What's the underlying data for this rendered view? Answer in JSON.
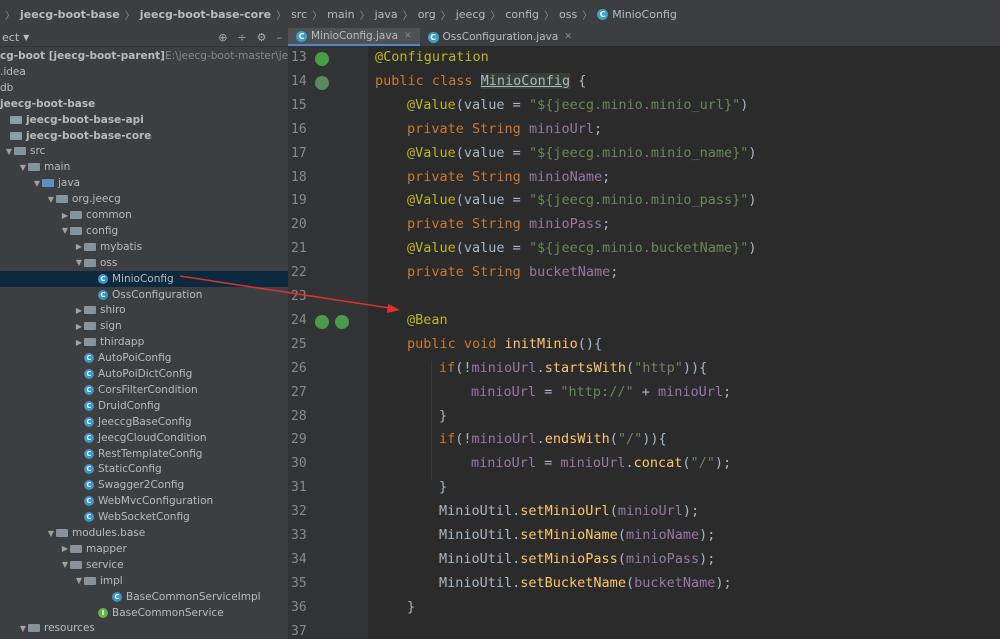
{
  "breadcrumb": [
    {
      "label": "jeecg-boot-base",
      "bold": true
    },
    {
      "label": "jeecg-boot-base-core",
      "bold": true
    },
    {
      "label": "src",
      "bold": false
    },
    {
      "label": "main",
      "bold": false
    },
    {
      "label": "java",
      "bold": false
    },
    {
      "label": "org",
      "bold": false
    },
    {
      "label": "jeecg",
      "bold": false
    },
    {
      "label": "config",
      "bold": false
    },
    {
      "label": "oss",
      "bold": false
    },
    {
      "label": "MinioConfig",
      "bold": false
    }
  ],
  "project_panel": {
    "title": "ect",
    "tree": [
      {
        "label": "cg-boot [jeecg-boot-parent]",
        "suffix": " E:\\jeecg-boot-master\\jeecg-boot",
        "indent": 0,
        "arrow": "",
        "icon": "",
        "bold": true
      },
      {
        "label": ".idea",
        "indent": 0,
        "arrow": "",
        "icon": "",
        "bold": false
      },
      {
        "label": "db",
        "indent": 0,
        "arrow": "",
        "icon": "",
        "bold": false
      },
      {
        "label": "jeecg-boot-base",
        "indent": 0,
        "arrow": "",
        "icon": "",
        "bold": true
      },
      {
        "label": "jeecg-boot-base-api",
        "indent": 0,
        "arrow": "",
        "icon": "folder-mod",
        "bold": true
      },
      {
        "label": "jeecg-boot-base-core",
        "indent": 0,
        "arrow": "",
        "icon": "folder-mod",
        "bold": true
      },
      {
        "label": "src",
        "indent": 0,
        "arrow": "▼",
        "icon": "folder",
        "bold": false
      },
      {
        "label": "main",
        "indent": 1,
        "arrow": "▼",
        "icon": "folder",
        "bold": false
      },
      {
        "label": "java",
        "indent": 2,
        "arrow": "▼",
        "icon": "folder-blue",
        "bold": false
      },
      {
        "label": "org.jeecg",
        "indent": 3,
        "arrow": "▼",
        "icon": "folder",
        "bold": false
      },
      {
        "label": "common",
        "indent": 4,
        "arrow": "▶",
        "icon": "folder",
        "bold": false
      },
      {
        "label": "config",
        "indent": 4,
        "arrow": "▼",
        "icon": "folder",
        "bold": false
      },
      {
        "label": "mybatis",
        "indent": 5,
        "arrow": "▶",
        "icon": "folder",
        "bold": false
      },
      {
        "label": "oss",
        "indent": 5,
        "arrow": "▼",
        "icon": "folder",
        "bold": false
      },
      {
        "label": "MinioConfig",
        "indent": 6,
        "arrow": "",
        "icon": "class",
        "bold": false,
        "selected": true
      },
      {
        "label": "OssConfiguration",
        "indent": 6,
        "arrow": "",
        "icon": "class",
        "bold": false
      },
      {
        "label": "shiro",
        "indent": 5,
        "arrow": "▶",
        "icon": "folder",
        "bold": false
      },
      {
        "label": "sign",
        "indent": 5,
        "arrow": "▶",
        "icon": "folder",
        "bold": false
      },
      {
        "label": "thirdapp",
        "indent": 5,
        "arrow": "▶",
        "icon": "folder",
        "bold": false
      },
      {
        "label": "AutoPoiConfig",
        "indent": 5,
        "arrow": "",
        "icon": "class",
        "bold": false
      },
      {
        "label": "AutoPoiDictConfig",
        "indent": 5,
        "arrow": "",
        "icon": "class",
        "bold": false
      },
      {
        "label": "CorsFilterCondition",
        "indent": 5,
        "arrow": "",
        "icon": "class",
        "bold": false
      },
      {
        "label": "DruidConfig",
        "indent": 5,
        "arrow": "",
        "icon": "class",
        "bold": false
      },
      {
        "label": "JeeccgBaseConfig",
        "indent": 5,
        "arrow": "",
        "icon": "class",
        "bold": false
      },
      {
        "label": "JeecgCloudCondition",
        "indent": 5,
        "arrow": "",
        "icon": "class",
        "bold": false
      },
      {
        "label": "RestTemplateConfig",
        "indent": 5,
        "arrow": "",
        "icon": "class",
        "bold": false
      },
      {
        "label": "StaticConfig",
        "indent": 5,
        "arrow": "",
        "icon": "class",
        "bold": false
      },
      {
        "label": "Swagger2Config",
        "indent": 5,
        "arrow": "",
        "icon": "class",
        "bold": false
      },
      {
        "label": "WebMvcConfiguration",
        "indent": 5,
        "arrow": "",
        "icon": "class",
        "bold": false
      },
      {
        "label": "WebSocketConfig",
        "indent": 5,
        "arrow": "",
        "icon": "class",
        "bold": false
      },
      {
        "label": "modules.base",
        "indent": 3,
        "arrow": "▼",
        "icon": "folder",
        "bold": false
      },
      {
        "label": "mapper",
        "indent": 4,
        "arrow": "▶",
        "icon": "folder",
        "bold": false
      },
      {
        "label": "service",
        "indent": 4,
        "arrow": "▼",
        "icon": "folder",
        "bold": false
      },
      {
        "label": "impl",
        "indent": 5,
        "arrow": "▼",
        "icon": "folder",
        "bold": false
      },
      {
        "label": "BaseCommonServiceImpl",
        "indent": 7,
        "arrow": "",
        "icon": "class",
        "bold": false
      },
      {
        "label": "BaseCommonService",
        "indent": 6,
        "arrow": "",
        "icon": "interface",
        "bold": false
      },
      {
        "label": "resources",
        "indent": 1,
        "arrow": "▼",
        "icon": "folder",
        "bold": false
      }
    ]
  },
  "tabs": [
    {
      "label": "MinioConfig.java",
      "active": true
    },
    {
      "label": "OssConfiguration.java",
      "active": false
    }
  ],
  "editor": {
    "lines": [
      {
        "n": "13",
        "ind": 0,
        "tokens": [
          [
            "ann",
            "@Configuration"
          ]
        ]
      },
      {
        "n": "14",
        "ind": 0,
        "tokens": [
          [
            "kw",
            "public class "
          ],
          [
            "classname",
            "MinioConfig"
          ],
          [
            "cls2",
            " {"
          ]
        ]
      },
      {
        "n": "15",
        "ind": 1,
        "tokens": [
          [
            "ann",
            "@Value"
          ],
          [
            "cls2",
            "(value = "
          ],
          [
            "str",
            "\"${jeecg.minio.minio_url}\""
          ],
          [
            "cls2",
            ")"
          ]
        ]
      },
      {
        "n": "16",
        "ind": 1,
        "tokens": [
          [
            "kw",
            "private "
          ],
          [
            "kw",
            "String "
          ],
          [
            "fld",
            "minioUrl"
          ],
          [
            "cls2",
            ";"
          ]
        ]
      },
      {
        "n": "17",
        "ind": 1,
        "tokens": [
          [
            "ann",
            "@Value"
          ],
          [
            "cls2",
            "(value = "
          ],
          [
            "str",
            "\"${jeecg.minio.minio_name}\""
          ],
          [
            "cls2",
            ")"
          ]
        ]
      },
      {
        "n": "18",
        "ind": 1,
        "tokens": [
          [
            "kw",
            "private "
          ],
          [
            "kw",
            "String "
          ],
          [
            "fld",
            "minioName"
          ],
          [
            "cls2",
            ";"
          ]
        ]
      },
      {
        "n": "19",
        "ind": 1,
        "tokens": [
          [
            "ann",
            "@Value"
          ],
          [
            "cls2",
            "(value = "
          ],
          [
            "str",
            "\"${jeecg.minio.minio_pass}\""
          ],
          [
            "cls2",
            ")"
          ]
        ]
      },
      {
        "n": "20",
        "ind": 1,
        "tokens": [
          [
            "kw",
            "private "
          ],
          [
            "kw",
            "String "
          ],
          [
            "fld",
            "minioPass"
          ],
          [
            "cls2",
            ";"
          ]
        ]
      },
      {
        "n": "21",
        "ind": 1,
        "tokens": [
          [
            "ann",
            "@Value"
          ],
          [
            "cls2",
            "(value = "
          ],
          [
            "str",
            "\"${jeecg.minio.bucketName}\""
          ],
          [
            "cls2",
            ")"
          ]
        ]
      },
      {
        "n": "22",
        "ind": 1,
        "tokens": [
          [
            "kw",
            "private "
          ],
          [
            "kw",
            "String "
          ],
          [
            "fld",
            "bucketName"
          ],
          [
            "cls2",
            ";"
          ]
        ]
      },
      {
        "n": "23",
        "ind": 0,
        "tokens": []
      },
      {
        "n": "24",
        "ind": 1,
        "tokens": [
          [
            "ann",
            "@Bean"
          ]
        ]
      },
      {
        "n": "25",
        "ind": 1,
        "tokens": [
          [
            "kw",
            "public void "
          ],
          [
            "mth",
            "initMinio"
          ],
          [
            "cls2",
            "(){"
          ]
        ]
      },
      {
        "n": "26",
        "ind": 2,
        "tokens": [
          [
            "kw",
            "if"
          ],
          [
            "cls2",
            "(!"
          ],
          [
            "fld",
            "minioUrl"
          ],
          [
            "cls2",
            "."
          ],
          [
            "mth",
            "startsWith"
          ],
          [
            "cls2",
            "("
          ],
          [
            "str",
            "\"http\""
          ],
          [
            "cls2",
            ")){"
          ]
        ]
      },
      {
        "n": "27",
        "ind": 3,
        "tokens": [
          [
            "fld",
            "minioUrl"
          ],
          [
            "cls2",
            " = "
          ],
          [
            "str",
            "\"http://\""
          ],
          [
            "cls2",
            " + "
          ],
          [
            "fld",
            "minioUrl"
          ],
          [
            "cls2",
            ";"
          ]
        ]
      },
      {
        "n": "28",
        "ind": 2,
        "tokens": [
          [
            "cls2",
            "}"
          ]
        ]
      },
      {
        "n": "29",
        "ind": 2,
        "tokens": [
          [
            "kw",
            "if"
          ],
          [
            "cls2",
            "(!"
          ],
          [
            "fld",
            "minioUrl"
          ],
          [
            "cls2",
            "."
          ],
          [
            "mth",
            "endsWith"
          ],
          [
            "cls2",
            "("
          ],
          [
            "str",
            "\"/\""
          ],
          [
            "cls2",
            "))"
          ],
          [
            "cls2",
            "{"
          ]
        ]
      },
      {
        "n": "30",
        "ind": 3,
        "tokens": [
          [
            "fld",
            "minioUrl"
          ],
          [
            "cls2",
            " = "
          ],
          [
            "fld",
            "minioUrl"
          ],
          [
            "cls2",
            "."
          ],
          [
            "mth",
            "concat"
          ],
          [
            "cls2",
            "("
          ],
          [
            "str",
            "\"/\""
          ],
          [
            "cls2",
            ");"
          ]
        ]
      },
      {
        "n": "31",
        "ind": 2,
        "tokens": [
          [
            "cls2",
            "}"
          ]
        ]
      },
      {
        "n": "32",
        "ind": 2,
        "tokens": [
          [
            "cls2",
            "MinioUtil."
          ],
          [
            "mth",
            "setMinioUrl"
          ],
          [
            "cls2",
            "("
          ],
          [
            "fld",
            "minioUrl"
          ],
          [
            "cls2",
            ");"
          ]
        ]
      },
      {
        "n": "33",
        "ind": 2,
        "tokens": [
          [
            "cls2",
            "MinioUtil."
          ],
          [
            "mth",
            "setMinioName"
          ],
          [
            "cls2",
            "("
          ],
          [
            "fld",
            "minioName"
          ],
          [
            "cls2",
            ");"
          ]
        ]
      },
      {
        "n": "34",
        "ind": 2,
        "tokens": [
          [
            "cls2",
            "MinioUtil."
          ],
          [
            "mth",
            "setMinioPass"
          ],
          [
            "cls2",
            "("
          ],
          [
            "fld",
            "minioPass"
          ],
          [
            "cls2",
            ");"
          ]
        ]
      },
      {
        "n": "35",
        "ind": 2,
        "tokens": [
          [
            "cls2",
            "MinioUtil."
          ],
          [
            "mth",
            "setBucketName"
          ],
          [
            "cls2",
            "("
          ],
          [
            "fld",
            "bucketName"
          ],
          [
            "cls2",
            ");"
          ]
        ]
      },
      {
        "n": "36",
        "ind": 1,
        "tokens": [
          [
            "cls2",
            "}"
          ]
        ]
      },
      {
        "n": "37",
        "ind": 0,
        "tokens": []
      }
    ]
  }
}
